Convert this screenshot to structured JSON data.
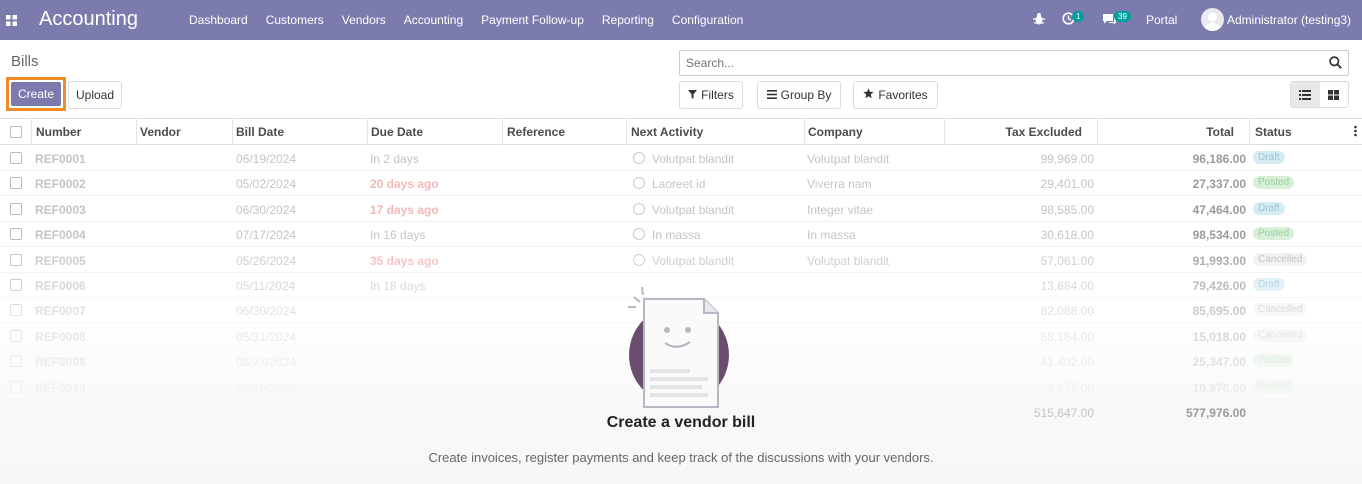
{
  "app": {
    "brand": "Accounting"
  },
  "nav": {
    "menu": [
      "Dashboard",
      "Customers",
      "Vendors",
      "Accounting",
      "Payment Follow-up",
      "Reporting",
      "Configuration"
    ],
    "activity_count": "1",
    "messages_count": "39",
    "portal": "Portal",
    "user": "Administrator (testing3)"
  },
  "control": {
    "breadcrumb": "Bills",
    "create_label": "Create",
    "upload_label": "Upload",
    "search_placeholder": "Search...",
    "filters_label": "Filters",
    "groupby_label": "Group By",
    "favorites_label": "Favorites"
  },
  "table": {
    "headers": [
      "Number",
      "Vendor",
      "Bill Date",
      "Due Date",
      "Reference",
      "Next Activity",
      "Company",
      "Tax Excluded",
      "Total",
      "Status"
    ],
    "rows": [
      {
        "number": "REF0001",
        "bill_date": "06/19/2024",
        "due": "In 2 days",
        "due_late": false,
        "activity": "Volutpat blandit",
        "company": "Volutpat blandit",
        "tax": "99,969.00",
        "total": "96,186.00",
        "status": "Draft"
      },
      {
        "number": "REF0002",
        "bill_date": "05/02/2024",
        "due": "20 days ago",
        "due_late": true,
        "activity": "Laoreet id",
        "company": "Viverra nam",
        "tax": "29,401.00",
        "total": "27,337.00",
        "status": "Posted"
      },
      {
        "number": "REF0003",
        "bill_date": "06/30/2024",
        "due": "17 days ago",
        "due_late": true,
        "activity": "Volutpat blandit",
        "company": "Integer vitae",
        "tax": "98,585.00",
        "total": "47,464.00",
        "status": "Draft"
      },
      {
        "number": "REF0004",
        "bill_date": "07/17/2024",
        "due": "In 16 days",
        "due_late": false,
        "activity": "In massa",
        "company": "In massa",
        "tax": "30,618.00",
        "total": "98,534.00",
        "status": "Posted"
      },
      {
        "number": "REF0005",
        "bill_date": "05/26/2024",
        "due": "35 days ago",
        "due_late": true,
        "activity": "Volutpat blandit",
        "company": "Volutpat blandit",
        "tax": "57,061.00",
        "total": "91,993.00",
        "status": "Cancelled"
      },
      {
        "number": "REF0006",
        "bill_date": "05/11/2024",
        "due": "In 18 days",
        "due_late": false,
        "activity": "",
        "company": "",
        "tax": "13,684.00",
        "total": "79,426.00",
        "status": "Draft"
      },
      {
        "number": "REF0007",
        "bill_date": "06/30/2024",
        "due": "",
        "due_late": false,
        "activity": "",
        "company": "",
        "tax": "82,088.00",
        "total": "85,695.00",
        "status": "Cancelled"
      },
      {
        "number": "REF0008",
        "bill_date": "05/31/2024",
        "due": "",
        "due_late": false,
        "activity": "",
        "company": "",
        "tax": "58,164.00",
        "total": "15,018.00",
        "status": "Cancelled"
      },
      {
        "number": "REF0009",
        "bill_date": "06/27/2024",
        "due": "",
        "due_late": false,
        "activity": "",
        "company": "",
        "tax": "41,402.00",
        "total": "25,347.00",
        "status": "Posted"
      },
      {
        "number": "REF0010",
        "bill_date": "06/16/2024",
        "due": "",
        "due_late": false,
        "activity": "",
        "company": "",
        "tax": "4,675.00",
        "total": "10,976.00",
        "status": "Posted"
      }
    ],
    "sum_tax": "515,647.00",
    "sum_total": "577,976.00"
  },
  "help": {
    "title": "Create a vendor bill",
    "text": "Create invoices, register payments and keep track of the discussions with your vendors."
  },
  "colors": {
    "navbar": "#7c7bad",
    "highlight": "#f28c28",
    "badge": "#00a09d"
  }
}
